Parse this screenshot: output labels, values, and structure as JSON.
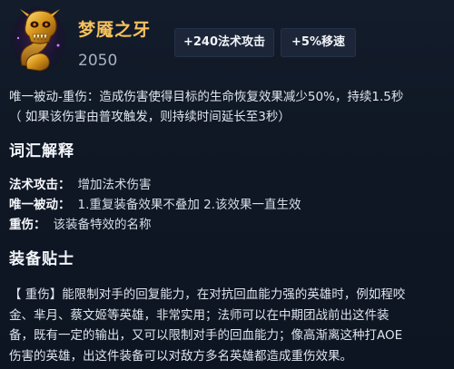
{
  "item": {
    "name": "梦魇之牙",
    "price": "2050",
    "stats": [
      "+240法术攻击",
      "+5%移速"
    ]
  },
  "passive": {
    "line1": "唯一被动-重伤：造成伤害使得目标的生命恢复效果减少50%，持续1.5秒",
    "line2": "（ 如果该伤害由普攻触发，则持续时间延长至3秒）"
  },
  "glossary": {
    "title": "词汇解释",
    "rows": [
      {
        "term": "法术攻击：",
        "definition": "增加法术伤害"
      },
      {
        "term": "唯一被动：",
        "definition": "1.重复装备效果不叠加 2.该效果一直生效"
      },
      {
        "term": "重伤：",
        "definition": "该装备特效的名称"
      }
    ]
  },
  "tips": {
    "title": "装备贴士",
    "lines": [
      "【 重伤】能限制对手的回复能力，在对抗回血能力强的英雄时，例如程咬",
      "金、芈月、蔡文姬等英雄，非常实用；法师可以在中期团战前出这件装",
      "备，既有一定的输出，又可以限制对手的回血能力；像高渐离这种打AOE",
      "伤害的英雄，出这件装备可以对敌方多名英雄都造成重伤效果。"
    ]
  },
  "colors": {
    "background": "#101826",
    "item_name": "#f6c15d",
    "tag_background": "#1c2638",
    "price": "#a8b2c2"
  },
  "icons": {
    "item_icon": "golden-serpent-skull-icon"
  }
}
